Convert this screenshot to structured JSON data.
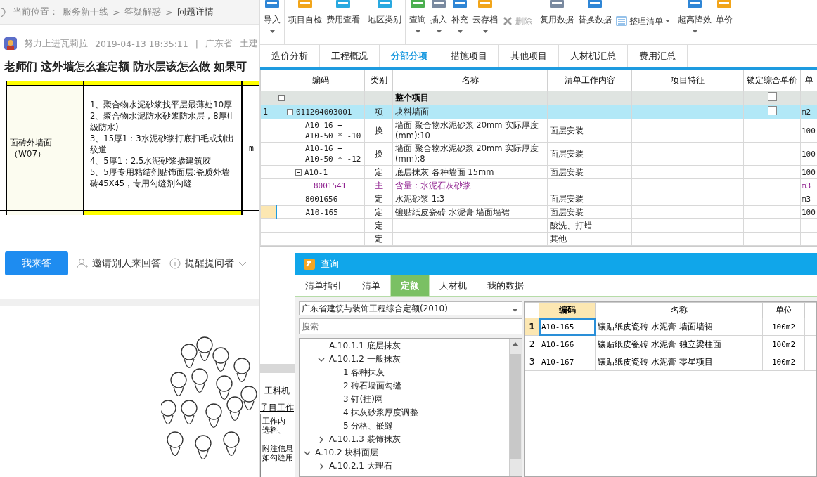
{
  "breadcrumb": [
    {
      "text": "当前位置：",
      "kind": "label"
    },
    {
      "text": "服务新干线",
      "kind": "link"
    },
    {
      "text": ">",
      "kind": "separator"
    },
    {
      "text": "答疑解惑",
      "kind": "link"
    },
    {
      "text": ">",
      "kind": "separator"
    },
    {
      "text": "问题详情",
      "kind": "current"
    }
  ],
  "question": {
    "author": "努力上进瓦莉拉",
    "time": "2019-04-13 18:35:11",
    "divider": "|",
    "tags": [
      "广东省",
      "土建"
    ],
    "title": "老师们 这外墙怎么套定额 防水层该怎么做 如果可"
  },
  "attachment": {
    "spec_name": [
      "面砖外墙面",
      "（W07）"
    ],
    "spec_lines": [
      "1、聚合物水泥砂浆找平层最薄处10厚",
      "2、聚合物水泥防水砂浆防水层，8厚(I级防水)",
      "3、15厚1：3水泥砂浆打底扫毛或划出纹道",
      "4、5厚1：2.5水泥砂浆掺建筑胶",
      "5、5厚专用粘结剂贴饰面层:瓷质外墙砖45X45，专用勾缝剂勾缝"
    ],
    "unit": "m"
  },
  "actions": {
    "answer": "我来答",
    "invite": "邀请别人来回答",
    "remind": "提醒提问者"
  },
  "toolbar": [
    [
      {
        "label": "导入",
        "kind": "large",
        "caret": true,
        "disabled": false
      }
    ],
    [
      {
        "label": "项目自检",
        "kind": "large",
        "caret": false,
        "disabled": false
      },
      {
        "label": "费用查看",
        "kind": "large",
        "caret": false,
        "disabled": false
      }
    ],
    [
      {
        "label": "地区类别",
        "kind": "large",
        "caret": false,
        "disabled": false
      }
    ],
    [
      {
        "label": "查询",
        "kind": "large",
        "caret": true,
        "disabled": false
      },
      {
        "label": "插入",
        "kind": "large",
        "caret": true,
        "disabled": false
      },
      {
        "label": "补充",
        "kind": "large",
        "caret": true,
        "disabled": false
      },
      {
        "label": "云存档",
        "kind": "large",
        "caret": true,
        "disabled": false
      },
      {
        "label": "删除",
        "kind": "small",
        "caret": false,
        "disabled": true
      }
    ],
    [
      {
        "label": "复用数据",
        "kind": "large",
        "caret": false,
        "disabled": false
      },
      {
        "label": "替换数据",
        "kind": "large",
        "caret": false,
        "disabled": false
      },
      {
        "label": "整理清单",
        "kind": "small",
        "caret": true,
        "disabled": false
      }
    ],
    [
      {
        "label": "超高降效",
        "kind": "large",
        "caret": true,
        "disabled": false
      },
      {
        "label": "单价",
        "kind": "large",
        "caret": false,
        "disabled": false
      }
    ]
  ],
  "tabs": [
    {
      "label": "造价分析",
      "selected": false
    },
    {
      "label": "工程概况",
      "selected": false
    },
    {
      "label": "分部分项",
      "selected": true
    },
    {
      "label": "措施项目",
      "selected": false
    },
    {
      "label": "其他项目",
      "selected": false
    },
    {
      "label": "人材机汇总",
      "selected": false
    },
    {
      "label": "费用汇总",
      "selected": false
    }
  ],
  "table": {
    "columns": [
      "编码",
      "类别",
      "名称",
      "清单工作内容",
      "项目特征",
      "锁定综合单价",
      "单"
    ],
    "rows": [
      {
        "kind": "root",
        "name": "整个项目",
        "expanded": true,
        "locked": false,
        "selected": false,
        "current": false,
        "children": [
          {
            "kind": "item",
            "number": "1",
            "code": "011204003001",
            "type": "项",
            "name": "块料墙面",
            "unit": "m2",
            "expanded": true,
            "locked": false,
            "selected": true,
            "current": false,
            "children": [
              {
                "kind": "item",
                "code": "A10-16 +\nA10-50 * -10",
                "type": "换",
                "name": "墙面 聚合物水泥砂浆 20mm  实际厚度(mm):10",
                "work": "面层安装",
                "unit": "100",
                "selected": false,
                "current": false
              },
              {
                "kind": "item",
                "code": "A10-16 +\nA10-50 * -12",
                "type": "换",
                "name": "墙面 聚合物水泥砂浆 20mm  实际厚度(mm):8",
                "work": "面层安装",
                "unit": "100",
                "selected": false,
                "current": false
              },
              {
                "kind": "item",
                "code": "A10-1",
                "type": "定",
                "name": "底层抹灰 各种墙面 15mm",
                "work": "面层安装",
                "unit": "100",
                "expanded": true,
                "selected": false,
                "current": false,
                "children": [
                  {
                    "kind": "material",
                    "code": "8001541",
                    "type": "主",
                    "name": "含量：水泥石灰砂浆",
                    "unit": "m3",
                    "selected": false,
                    "current": false
                  }
                ]
              },
              {
                "kind": "item",
                "code": "8001656",
                "type": "定",
                "name": "水泥砂浆 1:3",
                "work": "面层安装",
                "unit": "m3",
                "selected": false,
                "current": false
              },
              {
                "kind": "item",
                "code": "A10-165",
                "type": "定",
                "name": "镶贴纸皮瓷砖 水泥膏 墙面墙裙",
                "work": "面层安装",
                "unit": "100",
                "selected": false,
                "current": true
              },
              {
                "kind": "item",
                "type": "定",
                "work": "酸洗、打蜡",
                "selected": false,
                "current": false
              },
              {
                "kind": "item",
                "type": "定",
                "work": "其他",
                "selected": false,
                "current": false
              }
            ]
          }
        ]
      }
    ]
  },
  "lower_pane": {
    "tab": "工料机",
    "section": "子目工作",
    "paragraphs": [
      [
        "工作内",
        "选料、"
      ],
      [
        "附注信息",
        "如勾缝用"
      ]
    ]
  },
  "dialog": {
    "title": "查询",
    "tabs": [
      {
        "label": "清单指引",
        "selected": false
      },
      {
        "label": "清单",
        "selected": false
      },
      {
        "label": "定额",
        "selected": true
      },
      {
        "label": "人材机",
        "selected": false
      },
      {
        "label": "我的数据",
        "selected": false
      }
    ],
    "library": "广东省建筑与装饰工程综合定额(2010)",
    "search": {
      "placeholder": "搜索"
    },
    "tree": [
      {
        "children": [
          {
            "label": "A.10.1.1 底层抹灰"
          },
          {
            "label": "A.10.1.2 一般抹灰",
            "expanded": true,
            "children": [
              {
                "label": "1 各种抹灰"
              },
              {
                "label": "2 砖石墙面勾缝"
              },
              {
                "label": "3 钉(挂)网"
              },
              {
                "label": "4 抹灰砂浆厚度调整"
              },
              {
                "label": "5 分格、嵌缝"
              }
            ]
          },
          {
            "label": "A.10.1.3 装饰抹灰",
            "expanded": false
          }
        ]
      },
      {
        "label": "A.10.2 块料面层",
        "expanded": true,
        "children": [
          {
            "label": "A.10.2.1 大理石",
            "expanded": false
          }
        ]
      }
    ],
    "grid": {
      "columns": [
        "编码",
        "名称",
        "单位"
      ],
      "rows": [
        {
          "number": "1",
          "code": "A10-165",
          "name": "镶贴纸皮瓷砖 水泥膏 墙面墙裙",
          "unit": "100m2",
          "selected": true
        },
        {
          "number": "2",
          "code": "A10-166",
          "name": "镶贴纸皮瓷砖 水泥膏 独立梁柱面",
          "unit": "100m2",
          "selected": false
        },
        {
          "number": "3",
          "code": "A10-167",
          "name": "镶贴纸皮瓷砖 水泥膏 零星项目",
          "unit": "100m2",
          "selected": false
        }
      ]
    }
  }
}
